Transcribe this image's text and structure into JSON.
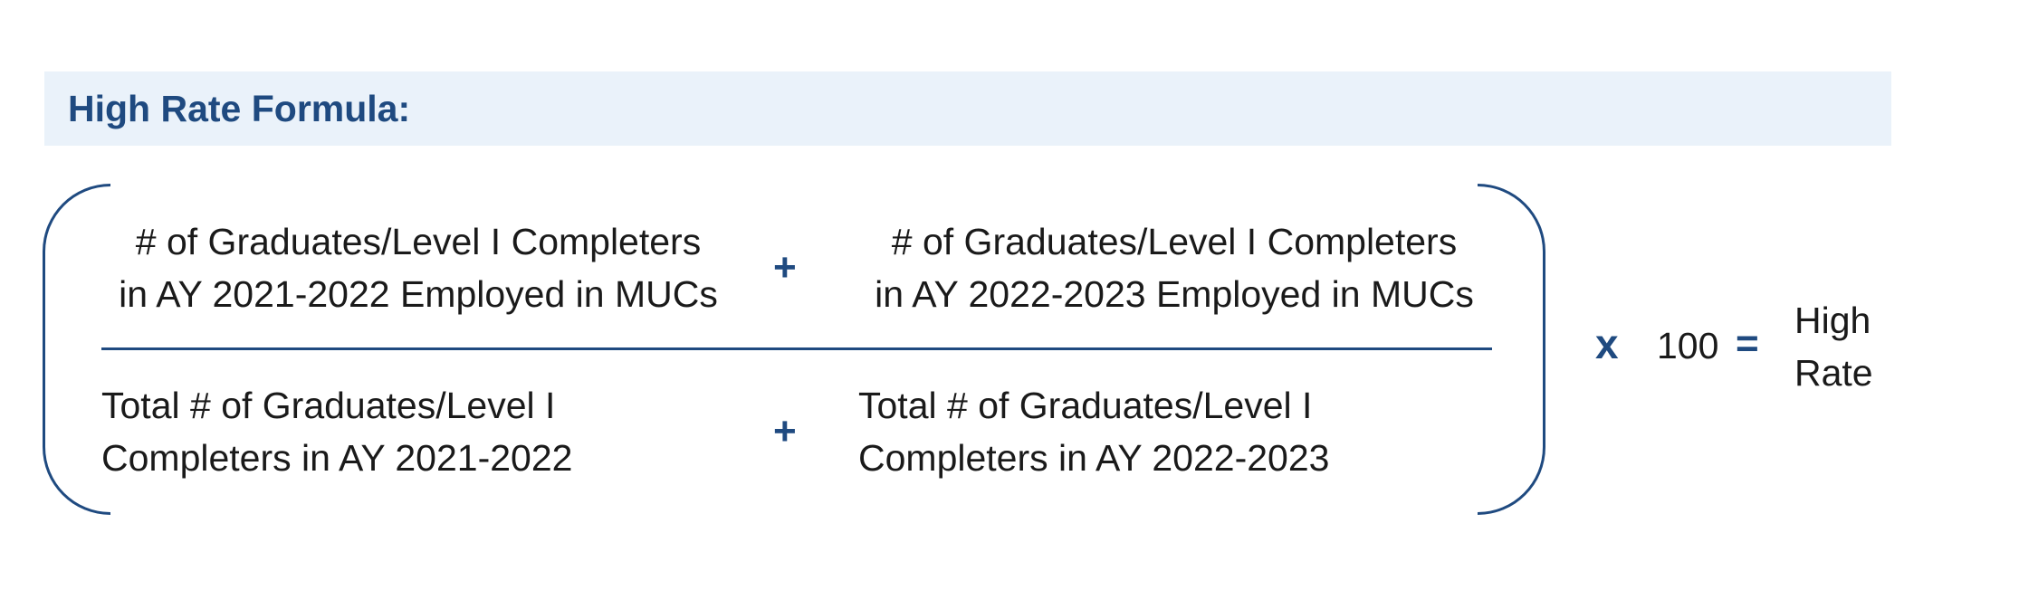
{
  "header": {
    "title": "High Rate Formula:"
  },
  "numerator": {
    "term_a": {
      "line1": "# of Graduates/Level I Completers",
      "line2": "in AY 2021-2022 Employed in MUCs"
    },
    "operator": "+",
    "term_b": {
      "line1": "# of Graduates/Level I Completers",
      "line2": "in AY 2022-2023 Employed in MUCs"
    }
  },
  "denominator": {
    "term_a": {
      "line1": "Total # of Graduates/Level I",
      "line2": "Completers in AY 2021-2022"
    },
    "operator": "+",
    "term_b": {
      "line1": "Total # of Graduates/Level I",
      "line2": "Completers in AY 2022-2023"
    }
  },
  "multiply": {
    "operator": "x",
    "value": "100"
  },
  "equals": "=",
  "result": {
    "line1": "High",
    "line2": "Rate"
  },
  "colors": {
    "accent": "#1f4a80",
    "header_bg": "#eaf2fa",
    "text": "#1a1a1a"
  }
}
